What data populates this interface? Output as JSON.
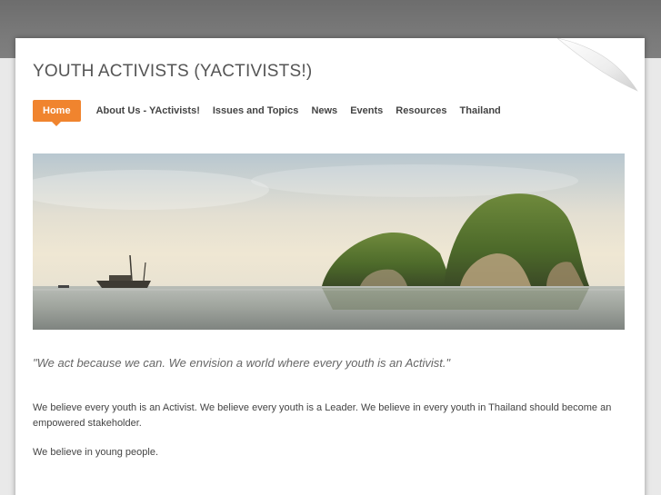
{
  "site": {
    "title": "YOUTH ACTIVISTS (YACTIVISTS!)"
  },
  "nav": {
    "items": [
      {
        "label": "Home",
        "active": true
      },
      {
        "label": "About Us - YActivists!",
        "active": false
      },
      {
        "label": "Issues and Topics",
        "active": false
      },
      {
        "label": "News",
        "active": false
      },
      {
        "label": "Events",
        "active": false
      },
      {
        "label": "Resources",
        "active": false
      },
      {
        "label": "Thailand",
        "active": false
      }
    ]
  },
  "content": {
    "quote": "\"We act because we can. We envision a world where every youth is an Activist.\"",
    "paragraph1": "We believe every youth is an Activist. We believe every youth is a Leader. We believe in every youth in Thailand should become an empowered stakeholder.",
    "paragraph2": "We believe in young people."
  },
  "colors": {
    "accent": "#f0842e",
    "header_band": "#7a7a7a",
    "background": "#e9e9e9"
  }
}
